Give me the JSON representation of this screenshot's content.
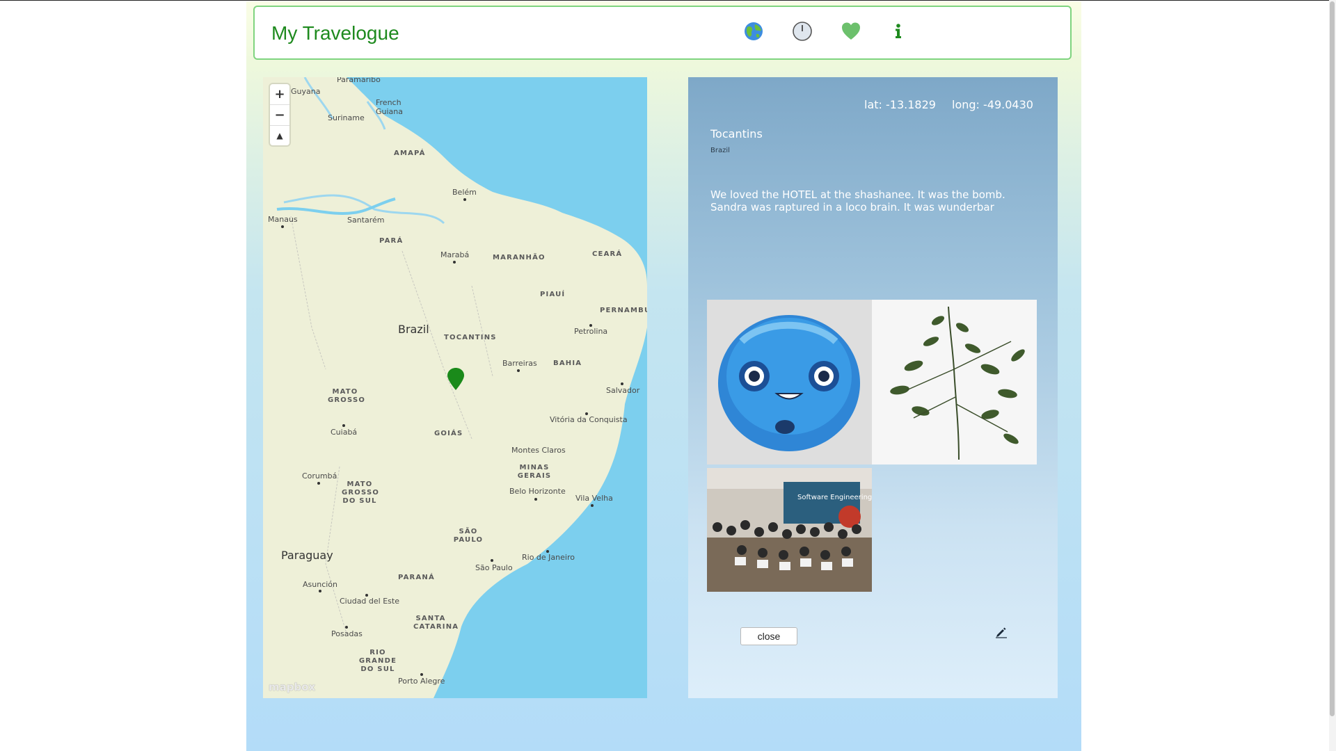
{
  "app": {
    "title": "My Travelogue"
  },
  "nav": {
    "icons": [
      "globe-icon",
      "clock-icon",
      "heart-icon",
      "info-icon"
    ],
    "colors": {
      "accent": "#1e8a1e",
      "heart": "#6cc06c",
      "info": "#1e8a1e"
    }
  },
  "map": {
    "countries": [
      "Brazil",
      "Paraguay",
      "Suriname",
      "French Guiana",
      "Guyana"
    ],
    "states": [
      "AMAPÁ",
      "PARÁ",
      "MARANHÃO",
      "CEARÁ",
      "PIAUÍ",
      "PERNAMBUC",
      "TOCANTINS",
      "BAHIA",
      "MATO GROSSO",
      "GOIÁS",
      "MINAS GERAIS",
      "MATO GROSSO DO SUL",
      "SÃO PAULO",
      "PARANÁ",
      "SANTA CATARINA",
      "RIO GRANDE DO SUL"
    ],
    "cities": [
      "Paramaribo",
      "Belém",
      "Manaus",
      "Santarém",
      "Marabá",
      "Petrolina",
      "Barreiras",
      "Salvador",
      "Vitória da Conquista",
      "Cuiabá",
      "Montes Claros",
      "Corumbá",
      "Belo Horizonte",
      "Vila Velha",
      "Rio de Janeiro",
      "São Paulo",
      "Asunción",
      "Ciudad del Este",
      "Posadas",
      "Porto Alegre"
    ],
    "zoom_in": "+",
    "zoom_out": "−",
    "compass": "▲",
    "attribution": "mapbox",
    "marker_color": "#1a8a1a"
  },
  "detail": {
    "lat_text": "lat: -13.1829",
    "long_text": "long: -49.0430",
    "place_name": "Tocantins",
    "country": "Brazil",
    "description": "We loved the HOTEL at the shashanee. It was the bomb. Sandra was raptured in a loco brain. It was wunderbar",
    "photos": [
      "blue-plush-photo",
      "fern-leaf-photo",
      "group-photo"
    ],
    "photo_caption_text": "Software Engineering",
    "close_label": "close"
  }
}
